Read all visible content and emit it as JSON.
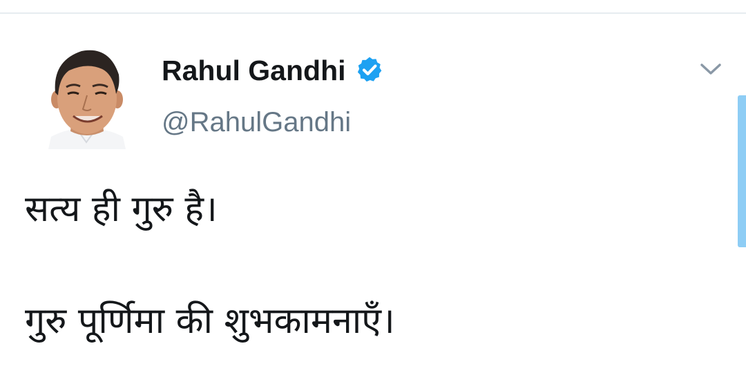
{
  "tweet": {
    "author": {
      "name": "Rahul Gandhi",
      "handle": "@RahulGandhi",
      "verified": true
    },
    "text_lines": [
      "सत्य ही गुरु है।",
      "गुरु पूर्णिमा की शुभकामनाएँ।"
    ]
  },
  "icons": {
    "verified": "verified-badge-icon",
    "menu": "chevron-down-icon",
    "avatar": "profile-photo"
  },
  "colors": {
    "name": "#14171a",
    "handle": "#657786",
    "verified_blue": "#1da1f2",
    "divider": "#e6ecf0",
    "scroll_indicator": "#8ecdf5"
  }
}
